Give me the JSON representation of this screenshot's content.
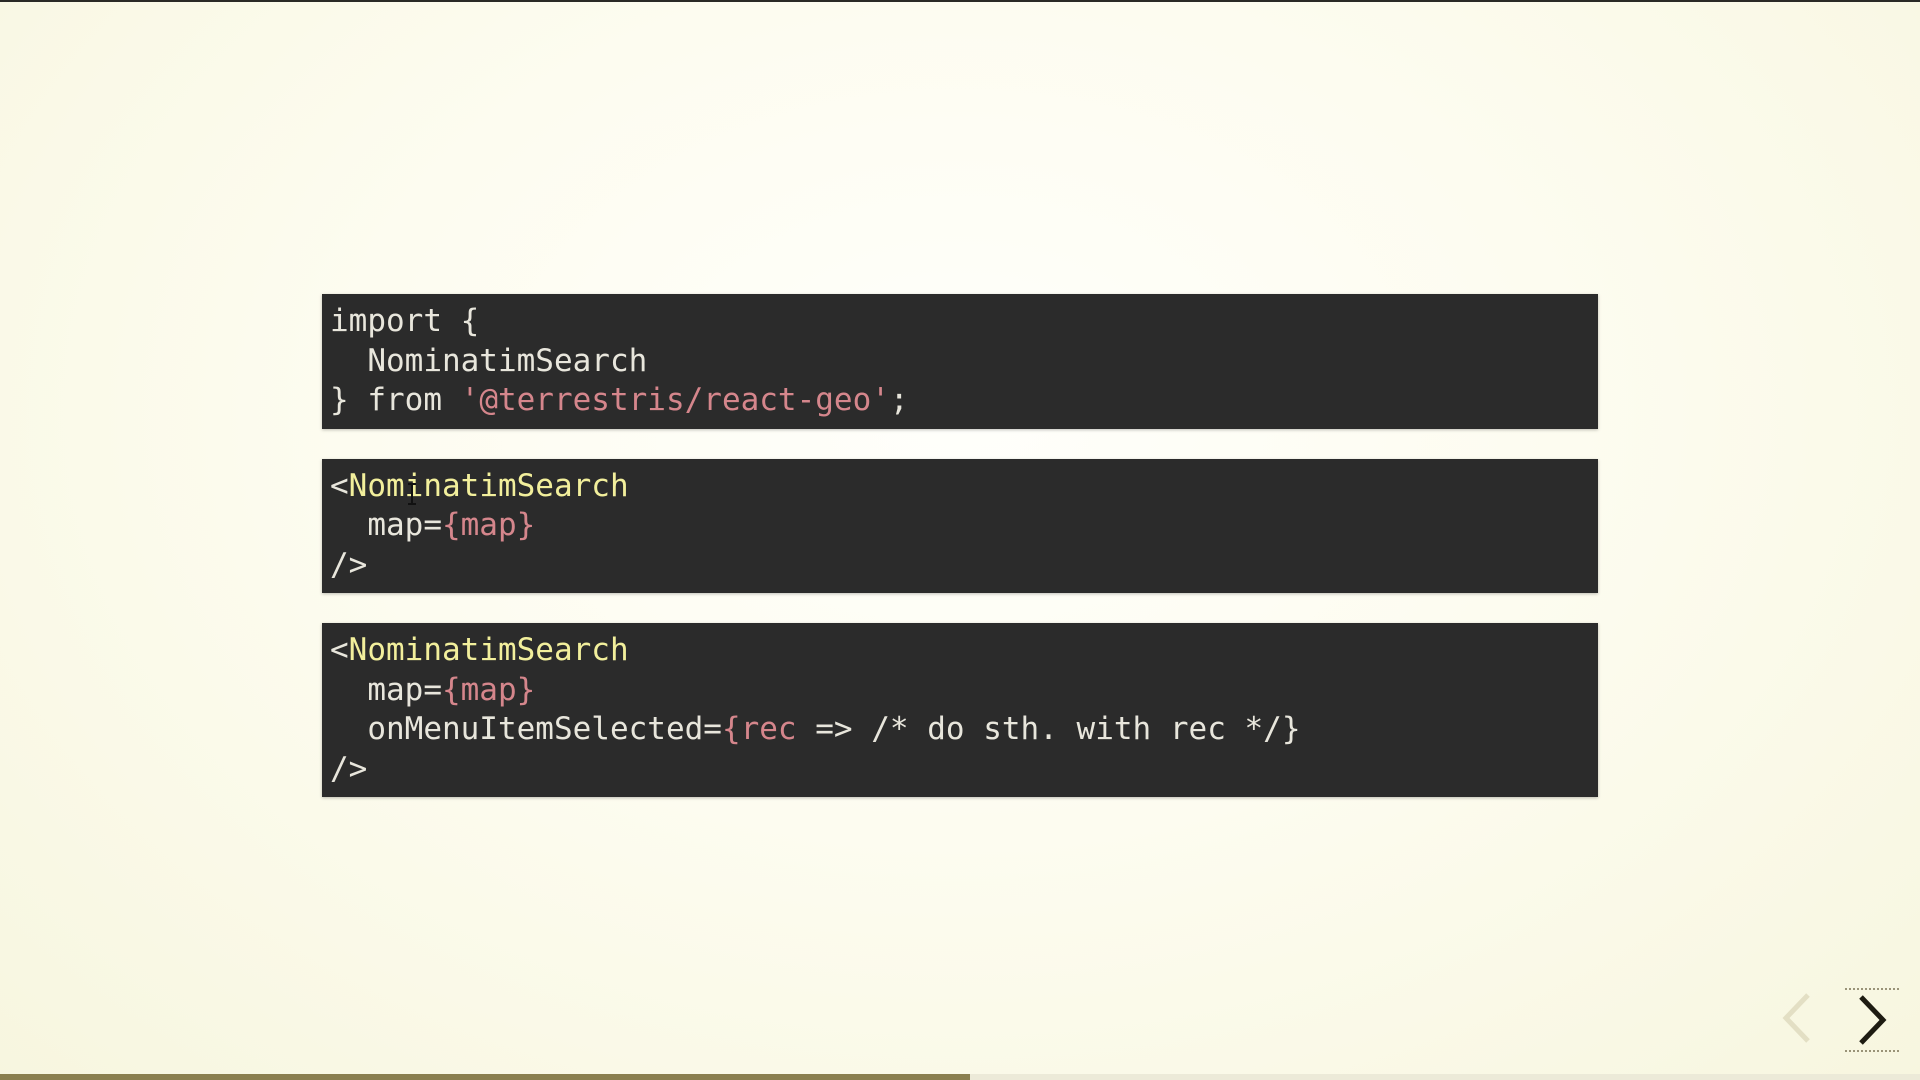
{
  "slide": {
    "code_blocks": [
      {
        "lines": [
          [
            {
              "t": "import {",
              "c": "plain"
            }
          ],
          [
            {
              "t": "  NominatimSearch",
              "c": "plain"
            }
          ],
          [
            {
              "t": "} from ",
              "c": "plain"
            },
            {
              "t": "'@terrestris/react-geo'",
              "c": "str"
            },
            {
              "t": ";",
              "c": "plain"
            }
          ]
        ]
      },
      {
        "lines": [
          [
            {
              "t": "<",
              "c": "plain"
            },
            {
              "t": "NominatimSearch",
              "c": "tag"
            }
          ],
          [
            {
              "t": "  map=",
              "c": "attr"
            },
            {
              "t": "{map}",
              "c": "str"
            }
          ],
          [
            {
              "t": "/>",
              "c": "plain"
            }
          ]
        ]
      },
      {
        "lines": [
          [
            {
              "t": "<",
              "c": "plain"
            },
            {
              "t": "NominatimSearch",
              "c": "tag"
            }
          ],
          [
            {
              "t": "  map=",
              "c": "attr"
            },
            {
              "t": "{map}",
              "c": "str"
            }
          ],
          [
            {
              "t": "  onMenuItemSelected=",
              "c": "attr"
            },
            {
              "t": "{rec",
              "c": "str"
            },
            {
              "t": " => /* do sth. with rec */}",
              "c": "comment"
            }
          ],
          [
            {
              "t": "/>",
              "c": "plain"
            }
          ]
        ]
      }
    ]
  },
  "navigation": {
    "prev_icon": "chevron-left-icon",
    "next_icon": "chevron-right-icon",
    "prev_enabled": false,
    "next_enabled": true
  },
  "progress": {
    "fraction": 0.505
  },
  "colors": {
    "code_background": "#2b2b2b",
    "code_plain": "#e8e6dc",
    "code_tag": "#f2ef9c",
    "code_string": "#d5868c",
    "accent": "#8a7f4f",
    "page_background": "#fdfcf0"
  }
}
